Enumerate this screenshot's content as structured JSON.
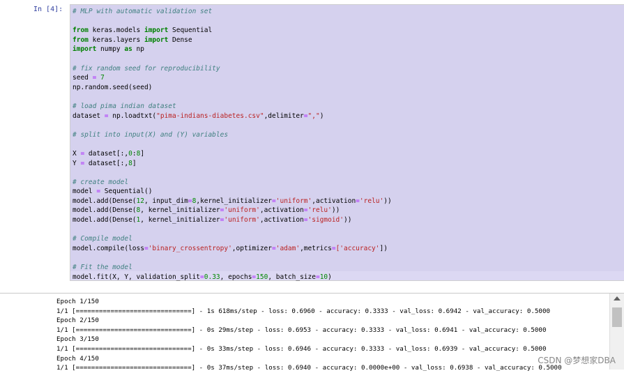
{
  "cell": {
    "prompt": "In  [4]:",
    "code_lines": [
      [
        {
          "t": "# MLP with automatic validation set",
          "c": "c"
        }
      ],
      [],
      [
        {
          "t": "from",
          "c": "k"
        },
        {
          "t": " keras.models "
        },
        {
          "t": "import",
          "c": "k"
        },
        {
          "t": " Sequential"
        }
      ],
      [
        {
          "t": "from",
          "c": "k"
        },
        {
          "t": " keras.layers "
        },
        {
          "t": "import",
          "c": "k"
        },
        {
          "t": " Dense"
        }
      ],
      [
        {
          "t": "import",
          "c": "k"
        },
        {
          "t": " numpy "
        },
        {
          "t": "as",
          "c": "k"
        },
        {
          "t": " np"
        }
      ],
      [],
      [
        {
          "t": "# fix random seed for reproducibility",
          "c": "c"
        }
      ],
      [
        {
          "t": "seed "
        },
        {
          "t": "=",
          "c": "o"
        },
        {
          "t": " "
        },
        {
          "t": "7",
          "c": "n"
        }
      ],
      [
        {
          "t": "np.random.seed(seed)"
        }
      ],
      [],
      [
        {
          "t": "# load pima indian dataset",
          "c": "c"
        }
      ],
      [
        {
          "t": "dataset "
        },
        {
          "t": "=",
          "c": "o"
        },
        {
          "t": " np.loadtxt("
        },
        {
          "t": "\"pima-indians-diabetes.csv\"",
          "c": "s"
        },
        {
          "t": ",delimiter"
        },
        {
          "t": "=",
          "c": "o"
        },
        {
          "t": "\",\"",
          "c": "s"
        },
        {
          "t": ")"
        }
      ],
      [],
      [
        {
          "t": "# split into input(X) and (Y) variables",
          "c": "c"
        }
      ],
      [],
      [
        {
          "t": "X "
        },
        {
          "t": "=",
          "c": "o"
        },
        {
          "t": " dataset[:,"
        },
        {
          "t": "0",
          "c": "n"
        },
        {
          "t": ":"
        },
        {
          "t": "8",
          "c": "n"
        },
        {
          "t": "]"
        }
      ],
      [
        {
          "t": "Y "
        },
        {
          "t": "=",
          "c": "o"
        },
        {
          "t": " dataset[:,"
        },
        {
          "t": "8",
          "c": "n"
        },
        {
          "t": "]"
        }
      ],
      [],
      [
        {
          "t": "# create model",
          "c": "c"
        }
      ],
      [
        {
          "t": "model "
        },
        {
          "t": "=",
          "c": "o"
        },
        {
          "t": " Sequential()"
        }
      ],
      [
        {
          "t": "model.add(Dense("
        },
        {
          "t": "12",
          "c": "n"
        },
        {
          "t": ", input_dim"
        },
        {
          "t": "=",
          "c": "o"
        },
        {
          "t": "8",
          "c": "n"
        },
        {
          "t": ",kernel_initializer"
        },
        {
          "t": "=",
          "c": "o"
        },
        {
          "t": "'uniform'",
          "c": "s"
        },
        {
          "t": ",activation"
        },
        {
          "t": "=",
          "c": "o"
        },
        {
          "t": "'relu'",
          "c": "s"
        },
        {
          "t": "))"
        }
      ],
      [
        {
          "t": "model.add(Dense("
        },
        {
          "t": "8",
          "c": "n"
        },
        {
          "t": ", kernel_initializer"
        },
        {
          "t": "=",
          "c": "o"
        },
        {
          "t": "'uniform'",
          "c": "s"
        },
        {
          "t": ",activation"
        },
        {
          "t": "=",
          "c": "o"
        },
        {
          "t": "'relu'",
          "c": "s"
        },
        {
          "t": "))"
        }
      ],
      [
        {
          "t": "model.add(Dense("
        },
        {
          "t": "1",
          "c": "n"
        },
        {
          "t": ", kernel_initializer"
        },
        {
          "t": "=",
          "c": "o"
        },
        {
          "t": "'uniform'",
          "c": "s"
        },
        {
          "t": ",activation"
        },
        {
          "t": "=",
          "c": "o"
        },
        {
          "t": "'sigmoid'",
          "c": "s"
        },
        {
          "t": "))"
        }
      ],
      [],
      [
        {
          "t": "# Compile model",
          "c": "c"
        }
      ],
      [
        {
          "t": "model.compile(loss"
        },
        {
          "t": "=",
          "c": "o"
        },
        {
          "t": "'binary_crossentropy'",
          "c": "s"
        },
        {
          "t": ",optimizer"
        },
        {
          "t": "=",
          "c": "o"
        },
        {
          "t": "'adam'",
          "c": "s"
        },
        {
          "t": ",metrics"
        },
        {
          "t": "=",
          "c": "o"
        },
        {
          "t": "['accuracy'",
          "c": "s"
        },
        {
          "t": "])"
        }
      ],
      [],
      [
        {
          "t": "# Fit the model",
          "c": "c"
        }
      ],
      [
        {
          "t": "model.fit(X, Y, validation_split"
        },
        {
          "t": "=",
          "c": "o"
        },
        {
          "t": "0.33",
          "c": "n"
        },
        {
          "t": ", epochs"
        },
        {
          "t": "=",
          "c": "o"
        },
        {
          "t": "150",
          "c": "n"
        },
        {
          "t": ", batch_size"
        },
        {
          "t": "=",
          "c": "o"
        },
        {
          "t": "10",
          "c": "n"
        },
        {
          "t": ")"
        }
      ]
    ]
  },
  "output": {
    "lines": [
      "Epoch 1/150",
      "1/1 [==============================] - 1s 618ms/step - loss: 0.6960 - accuracy: 0.3333 - val_loss: 0.6942 - val_accuracy: 0.5000",
      "Epoch 2/150",
      "1/1 [==============================] - 0s 29ms/step - loss: 0.6953 - accuracy: 0.3333 - val_loss: 0.6941 - val_accuracy: 0.5000",
      "Epoch 3/150",
      "1/1 [==============================] - 0s 33ms/step - loss: 0.6946 - accuracy: 0.3333 - val_loss: 0.6939 - val_accuracy: 0.5000",
      "Epoch 4/150",
      "1/1 [==============================] - 0s 37ms/step - loss: 0.6940 - accuracy: 0.0000e+00 - val_loss: 0.6938 - val_accuracy: 0.5000"
    ]
  },
  "watermark": "CSDN @梦想家DBA"
}
